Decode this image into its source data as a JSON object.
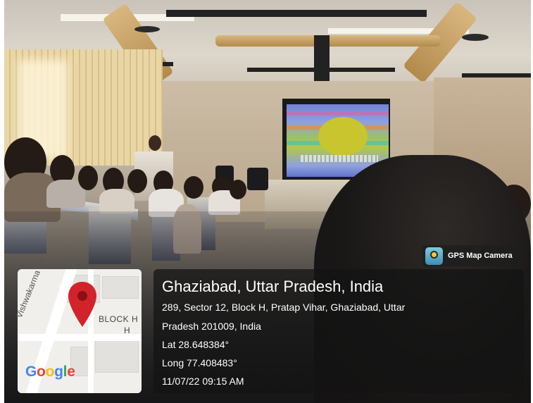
{
  "badge": {
    "label": "GPS Map Camera",
    "icon": "camera-pin-icon"
  },
  "map": {
    "street_label": "Vishwakarma Rd",
    "block_label_1": "BLOCK H",
    "block_label_2": "H",
    "logo": "Google",
    "pin_color": "#d3232a"
  },
  "location": {
    "title": "Ghaziabad, Uttar Pradesh, India",
    "address_line1": "289, Sector 12, Block H, Pratap Vihar, Ghaziabad, Uttar",
    "address_line2": "Pradesh 201009, India",
    "lat": "Lat 28.648384°",
    "long": "Long 77.408483°",
    "datetime": "11/07/22 09:15 AM"
  }
}
